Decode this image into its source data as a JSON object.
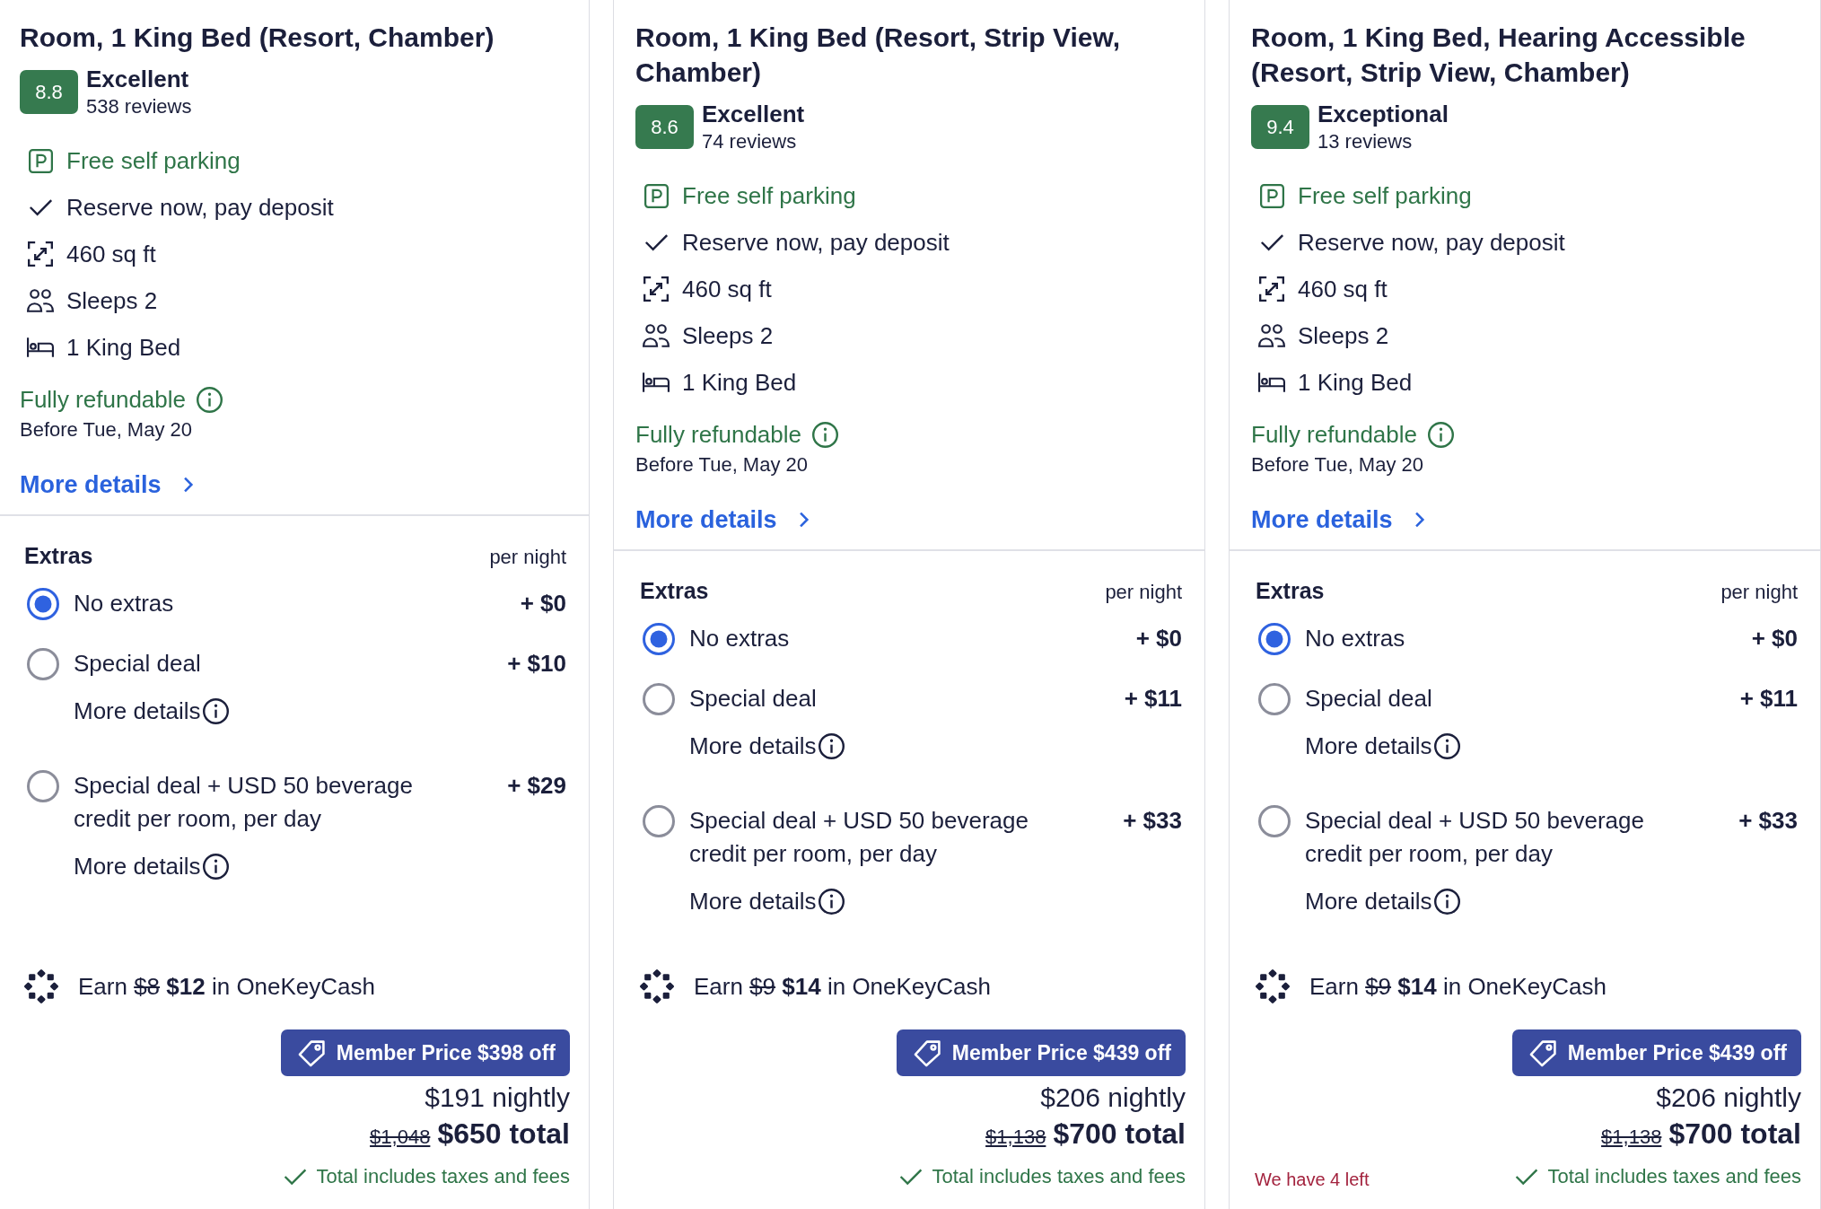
{
  "room_cards": [
    {
      "title": "Room, 1 King Bed (Resort, Chamber)",
      "rating": {
        "score": "8.8",
        "label": "Excellent",
        "reviews": "538 reviews"
      },
      "amenities": [
        {
          "kind": "parking",
          "text": "Free self parking"
        },
        {
          "kind": "deposit",
          "text": "Reserve now, pay deposit"
        },
        {
          "kind": "area",
          "text": "460 sq ft"
        },
        {
          "kind": "sleeps",
          "text": "Sleeps 2"
        },
        {
          "kind": "bed",
          "text": "1 King Bed"
        }
      ],
      "refund": {
        "label": "Fully refundable",
        "deadline": "Before Tue, May 20"
      },
      "details_link": "More details",
      "extras": {
        "heading": "Extras",
        "unit": "per night",
        "options": [
          {
            "label": "No extras",
            "price": "+ $0",
            "selected": true
          },
          {
            "label": "Special deal",
            "price": "+ $10",
            "selected": false,
            "details_link": "More details"
          },
          {
            "label": "Special deal + USD 50 beverage credit per room, per day",
            "price": "+ $29",
            "selected": false,
            "details_link": "More details"
          }
        ]
      },
      "reward": {
        "prefix": "Earn",
        "old_amount": "$8",
        "amount": "$12",
        "suffix": "in OneKeyCash"
      },
      "member_price": "Member Price $398 off",
      "nightly": "$191 nightly",
      "old_total": "$1,048",
      "total": "$650 total",
      "tax_note": "Total includes taxes and fees"
    },
    {
      "title": "Room, 1 King Bed (Resort, Strip View, Chamber)",
      "rating": {
        "score": "8.6",
        "label": "Excellent",
        "reviews": "74 reviews"
      },
      "amenities": [
        {
          "kind": "parking",
          "text": "Free self parking"
        },
        {
          "kind": "deposit",
          "text": "Reserve now, pay deposit"
        },
        {
          "kind": "area",
          "text": "460 sq ft"
        },
        {
          "kind": "sleeps",
          "text": "Sleeps 2"
        },
        {
          "kind": "bed",
          "text": "1 King Bed"
        }
      ],
      "refund": {
        "label": "Fully refundable",
        "deadline": "Before Tue, May 20"
      },
      "details_link": "More details",
      "extras": {
        "heading": "Extras",
        "unit": "per night",
        "options": [
          {
            "label": "No extras",
            "price": "+ $0",
            "selected": true
          },
          {
            "label": "Special deal",
            "price": "+ $11",
            "selected": false,
            "details_link": "More details"
          },
          {
            "label": "Special deal + USD 50 beverage credit per room, per day",
            "price": "+ $33",
            "selected": false,
            "details_link": "More details"
          }
        ]
      },
      "reward": {
        "prefix": "Earn",
        "old_amount": "$9",
        "amount": "$14",
        "suffix": "in OneKeyCash"
      },
      "member_price": "Member Price $439 off",
      "nightly": "$206 nightly",
      "old_total": "$1,138",
      "total": "$700 total",
      "tax_note": "Total includes taxes and fees"
    },
    {
      "title": "Room, 1 King Bed, Hearing Accessible (Resort, Strip View, Chamber)",
      "rating": {
        "score": "9.4",
        "label": "Exceptional",
        "reviews": "13 reviews"
      },
      "amenities": [
        {
          "kind": "parking",
          "text": "Free self parking"
        },
        {
          "kind": "deposit",
          "text": "Reserve now, pay deposit"
        },
        {
          "kind": "area",
          "text": "460 sq ft"
        },
        {
          "kind": "sleeps",
          "text": "Sleeps 2"
        },
        {
          "kind": "bed",
          "text": "1 King Bed"
        }
      ],
      "refund": {
        "label": "Fully refundable",
        "deadline": "Before Tue, May 20"
      },
      "details_link": "More details",
      "extras": {
        "heading": "Extras",
        "unit": "per night",
        "options": [
          {
            "label": "No extras",
            "price": "+ $0",
            "selected": true
          },
          {
            "label": "Special deal",
            "price": "+ $11",
            "selected": false,
            "details_link": "More details"
          },
          {
            "label": "Special deal + USD 50 beverage credit per room, per day",
            "price": "+ $33",
            "selected": false,
            "details_link": "More details"
          }
        ]
      },
      "reward": {
        "prefix": "Earn",
        "old_amount": "$9",
        "amount": "$14",
        "suffix": "in OneKeyCash"
      },
      "member_price": "Member Price $439 off",
      "nightly": "$206 nightly",
      "old_total": "$1,138",
      "total": "$700 total",
      "availability": "We have 4 left",
      "tax_note": "Total includes taxes and fees"
    }
  ]
}
